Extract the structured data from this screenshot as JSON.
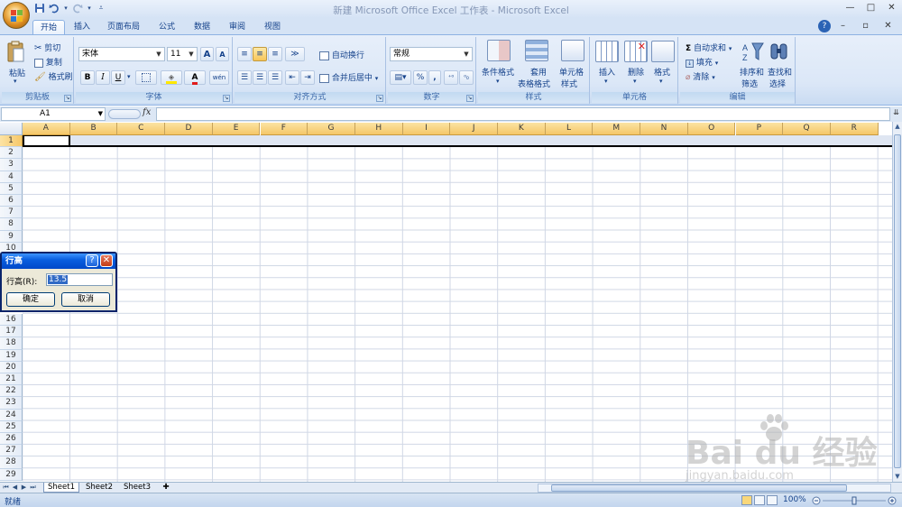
{
  "window": {
    "title": "新建 Microsoft Office Excel 工作表 - Microsoft Excel",
    "controls": [
      "—",
      "□",
      "✕"
    ]
  },
  "quick_access": {
    "icons": [
      "save-icon",
      "undo-icon",
      "redo-icon",
      "customize-icon"
    ]
  },
  "tabs": [
    {
      "label": "开始",
      "active": true
    },
    {
      "label": "插入"
    },
    {
      "label": "页面布局"
    },
    {
      "label": "公式"
    },
    {
      "label": "数据"
    },
    {
      "label": "审阅"
    },
    {
      "label": "视图"
    }
  ],
  "ribbon": {
    "clipboard": {
      "paste": "粘贴",
      "cut": "剪切",
      "copy": "复制",
      "format_painter": "格式刷",
      "label": "剪贴板"
    },
    "font": {
      "font_name": "宋体",
      "font_size": "11",
      "bold": "B",
      "italic": "I",
      "underline": "U",
      "grow": "A",
      "shrink": "A",
      "font_color": "A",
      "wen": "wén",
      "label": "字体"
    },
    "alignment": {
      "wrap_text": "自动换行",
      "merge_center": "合并后居中",
      "label": "对齐方式"
    },
    "number": {
      "format": "常规",
      "percent": "%",
      "comma": ",",
      "label": "数字"
    },
    "styles": {
      "conditional": "条件格式",
      "table_line1": "套用",
      "table_line2": "表格格式",
      "cell_line1": "单元格",
      "cell_line2": "样式",
      "label": "样式"
    },
    "cells": {
      "insert": "插入",
      "delete": "删除",
      "format": "格式",
      "label": "单元格"
    },
    "editing": {
      "autosum": "自动求和",
      "fill": "填充",
      "clear": "清除",
      "sort_line1": "排序和",
      "sort_line2": "筛选",
      "find_line1": "查找和",
      "find_line2": "选择",
      "label": "编辑"
    }
  },
  "formula_bar": {
    "name_box": "A1",
    "fx": "fx",
    "value": ""
  },
  "grid": {
    "columns": [
      "A",
      "B",
      "C",
      "D",
      "E",
      "F",
      "G",
      "H",
      "I",
      "J",
      "K",
      "L",
      "M",
      "N",
      "O",
      "P",
      "Q",
      "R"
    ],
    "rows_top": [
      "1",
      "2",
      "3",
      "4",
      "5",
      "6",
      "7",
      "8",
      "9",
      "10"
    ],
    "rows_bottom": [
      "16",
      "17",
      "18",
      "19",
      "20",
      "21",
      "22",
      "23",
      "24",
      "25",
      "26",
      "27",
      "28",
      "29"
    ],
    "selected_row": "1",
    "active_cell": "A1"
  },
  "sheets": [
    {
      "label": "Sheet1",
      "active": true
    },
    {
      "label": "Sheet2"
    },
    {
      "label": "Sheet3"
    }
  ],
  "status": {
    "text": "就绪",
    "zoom": "100%"
  },
  "dialog": {
    "title": "行高",
    "help": "?",
    "close": "✕",
    "field_label": "行高(R):",
    "field_value": "13.5",
    "ok": "确定",
    "cancel": "取消"
  },
  "watermark": {
    "text": "Bai du 经验",
    "sub": "jingyan.baidu.com"
  },
  "colors": {
    "ribbon_bg": "#dbe7f7",
    "header_highlight": "#f5c768",
    "dialog_title": "#0a5fe0",
    "accent": "#15428b"
  }
}
